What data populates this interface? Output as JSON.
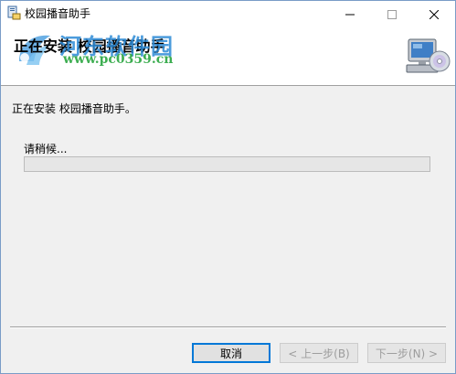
{
  "window": {
    "title": "校园播音助手",
    "controls": [
      "minimize",
      "maximize",
      "close"
    ]
  },
  "header": {
    "title": "正在安装 校园播音助手",
    "watermark_name": "河东软件园",
    "watermark_url": "www.pc0359.cn",
    "icon": "computer-cd-icon"
  },
  "content": {
    "status": "正在安装 校园播音助手。",
    "wait": "请稍候...",
    "progress": 0
  },
  "buttons": {
    "cancel": "取消",
    "back": "< 上一步(B)",
    "next": "下一步(N) >"
  },
  "colors": {
    "accent": "#0078d7",
    "watermark_blue": "#2d8bd6",
    "watermark_green": "#2aa640"
  }
}
